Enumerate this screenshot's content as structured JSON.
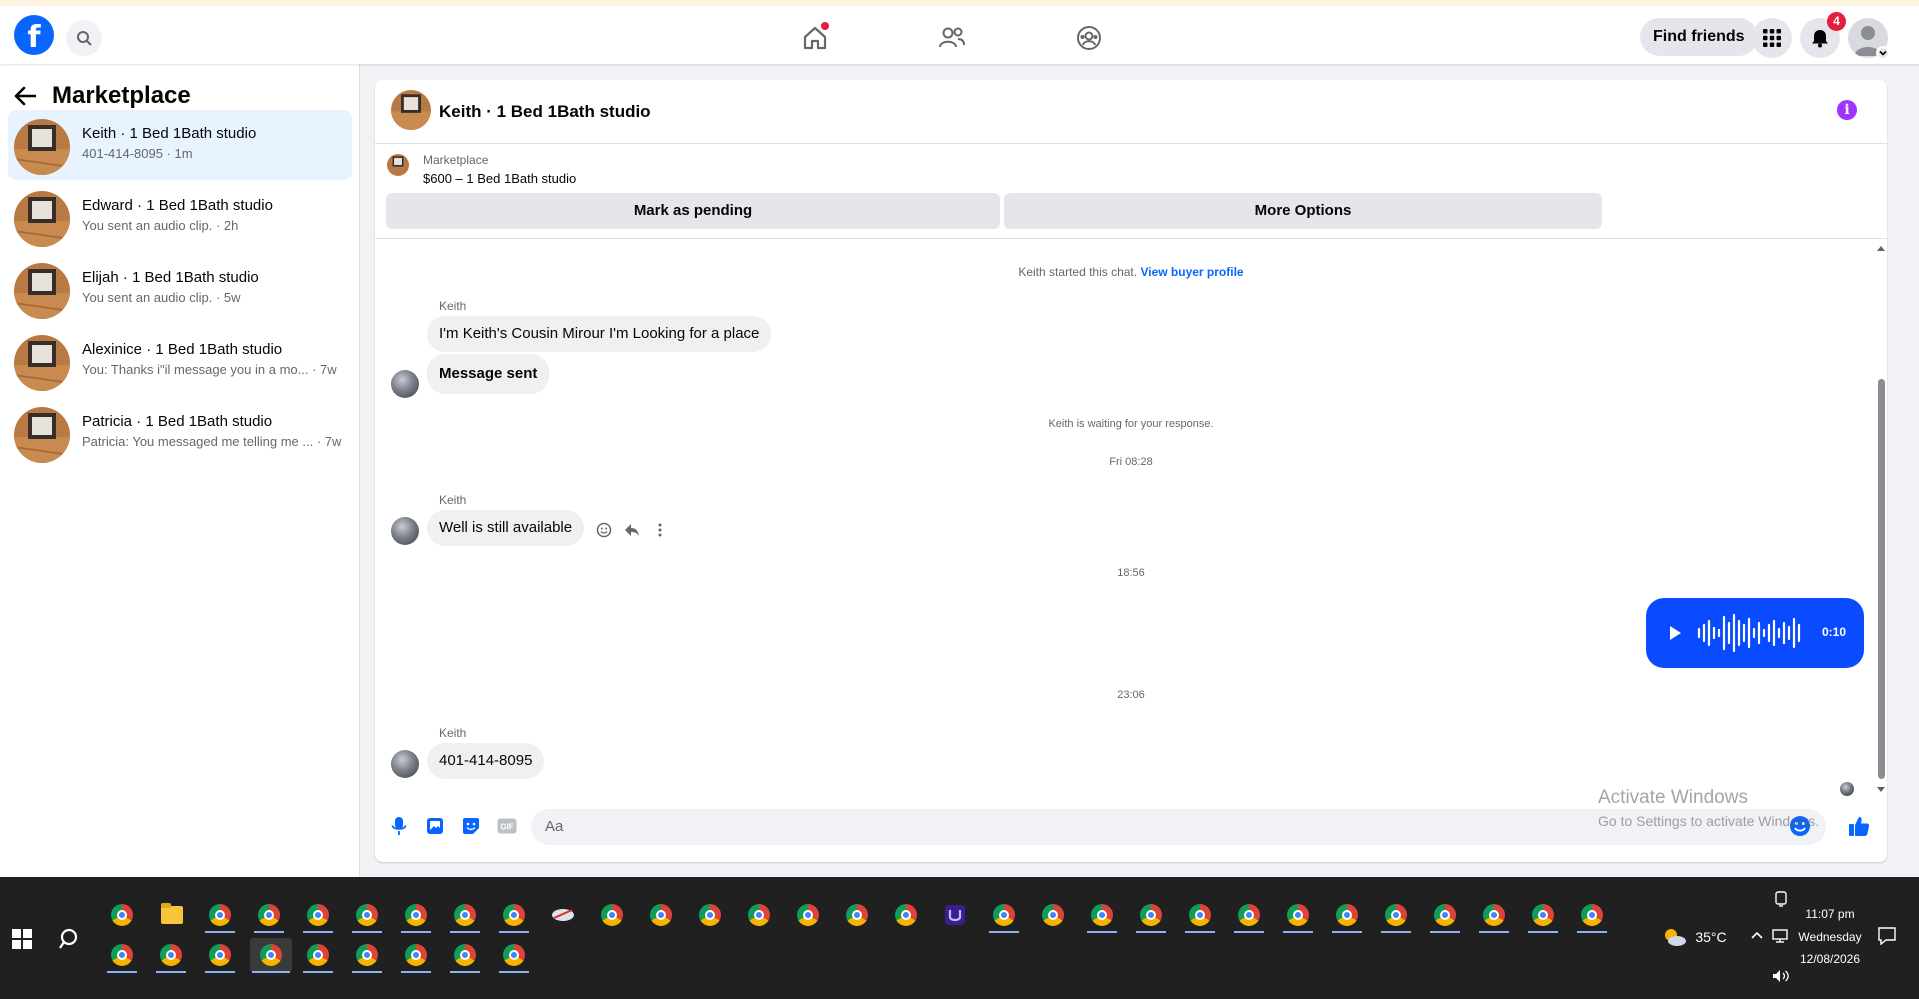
{
  "topbar": {
    "logo_letter": "f",
    "find_friends": "Find friends",
    "notification_count": "4"
  },
  "sidebar": {
    "title": "Marketplace",
    "conversations": [
      {
        "name": "Keith · 1 Bed 1Bath studio",
        "subtitle": "401-414-8095 · 1m"
      },
      {
        "name": "Edward · 1 Bed 1Bath studio",
        "subtitle": "You sent an audio clip. · 2h"
      },
      {
        "name": "Elijah · 1 Bed 1Bath studio",
        "subtitle": "You sent an audio clip. · 5w"
      },
      {
        "name": "Alexinice · 1 Bed 1Bath studio",
        "subtitle": "You: Thanks i\"il message you in a mo... · 7w"
      },
      {
        "name": "Patricia · 1 Bed 1Bath studio",
        "subtitle": "Patricia: You messaged me telling me ... · 7w"
      }
    ]
  },
  "chat": {
    "title": "Keith · 1 Bed 1Bath studio",
    "listing_category": "Marketplace",
    "listing_title": "$600 – 1 Bed 1Bath studio",
    "mark_pending": "Mark as pending",
    "more_options": "More Options",
    "started_text": "Keith started this chat.",
    "view_profile": "View buyer profile",
    "sender": "Keith",
    "msg1": "I'm Keith's Cousin Mirour I'm Looking for  a place",
    "msg2": "Message sent",
    "waiting": "Keith is waiting for your response.",
    "time1": "Fri 08:28",
    "msg3": "Well  is still available",
    "time2": "18:56",
    "audio_duration": "0:10",
    "time3": "23:06",
    "msg4": "401-414-8095",
    "composer_placeholder": "Aa"
  },
  "watermark": {
    "line1": "Activate Windows",
    "line2": "Go to Settings to activate Windows."
  },
  "taskbar": {
    "temperature": "35°C",
    "time": "11:07 pm",
    "day": "Wednesday",
    "date": "12/08/2026"
  },
  "colors": {
    "brand": "#0866ff",
    "audio_bubble": "#0a4bff",
    "notification_red": "#e41e3f",
    "info_purple": "#a033ff"
  },
  "icons": [
    "facebook-logo",
    "search-icon",
    "home-icon",
    "friends-icon",
    "groups-icon",
    "menu-grid-icon",
    "bell-icon",
    "back-arrow-icon",
    "info-icon",
    "emoji-icon",
    "reply-icon",
    "more-icon",
    "play-icon",
    "mic-icon",
    "photo-icon",
    "sticker-icon",
    "gif-icon",
    "like-icon"
  ]
}
